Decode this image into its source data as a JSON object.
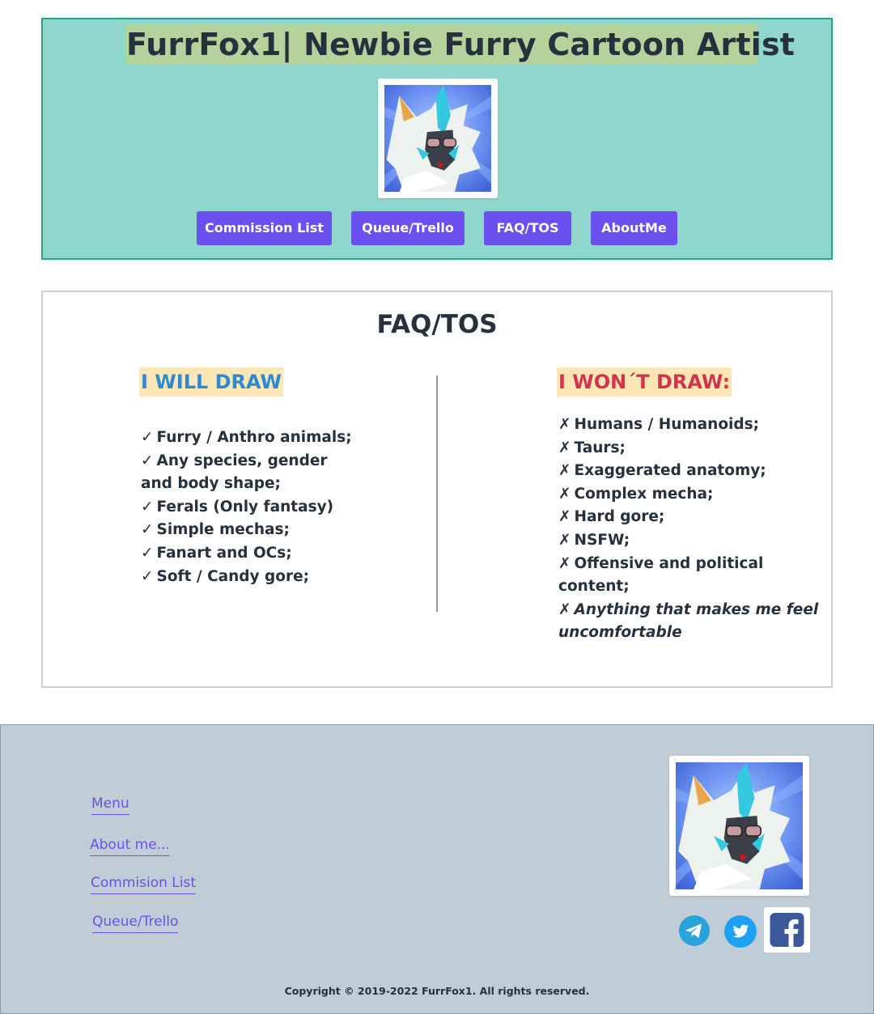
{
  "header": {
    "title": "FurrFox1| Newbie Furry Cartoon Artist",
    "avatar_icon": "fox-character-avatar",
    "nav": [
      "Commission List",
      "Queue/Trello",
      "FAQ/TOS",
      "AboutMe"
    ]
  },
  "faq": {
    "title": "FAQ/TOS",
    "will_draw": {
      "heading": "I WILL DRAW",
      "mark": "✓",
      "items": [
        "Furry / Anthro animals;",
        "Any species, gender and body shape;",
        "Ferals (Only fantasy)",
        "Simple mechas;",
        "Fanart and OCs;",
        "Soft / Candy gore;"
      ]
    },
    "wont_draw": {
      "heading": "I WON´T DRAW:",
      "mark": "✗",
      "items": [
        "Humans / Humanoids;",
        "Taurs;",
        "Exaggerated anatomy;",
        "Complex mecha;",
        "Hard gore;",
        "NSFW;",
        "Offensive and political content;",
        "Anything that makes me feel uncomfortable"
      ]
    }
  },
  "footer": {
    "links": [
      "Menu",
      "About me...",
      "Commision List",
      "Queue/Trello"
    ],
    "avatar_icon": "fox-character-avatar",
    "social": [
      "telegram-icon",
      "twitter-icon",
      "facebook-icon"
    ],
    "copyright": "Copyright © 2019-2022 FurrFox1. All rights reserved."
  },
  "colors": {
    "header_bg": "#8fd7cd",
    "title_highlight": "#b5d29c",
    "button": "#6b4ff0",
    "will_heading": "#2e8ad0",
    "wont_heading": "#d2344e",
    "heading_highlight": "#fbe6b6",
    "footer_bg": "#c1cdd6"
  }
}
